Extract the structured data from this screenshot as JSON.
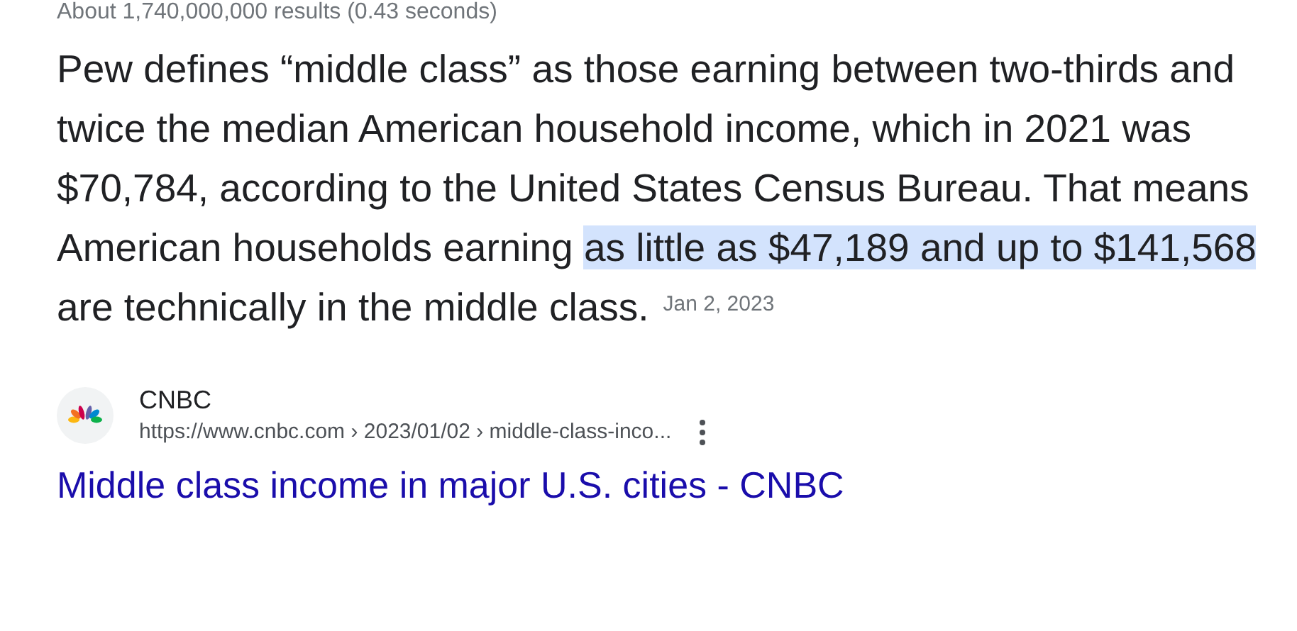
{
  "result_stats": "About 1,740,000,000 results (0.43 seconds)",
  "snippet": {
    "segments": [
      {
        "text": "Pew defines “middle class” as those earning between two-thirds and twice the median American household income, which in 2021 was $70,784, according to the United States Census Bureau. That means American households earning ",
        "highlighted": false
      },
      {
        "text": "as little as $47,189 and up to $141,568",
        "highlighted": true
      },
      {
        "text": " are technically in the middle class.",
        "highlighted": false
      }
    ],
    "date": "Jan 2, 2023"
  },
  "source": {
    "name": "CNBC",
    "url": "https://www.cnbc.com › 2023/01/02 › middle-class-inco...",
    "title": "Middle class income in major U.S. cities - CNBC"
  }
}
